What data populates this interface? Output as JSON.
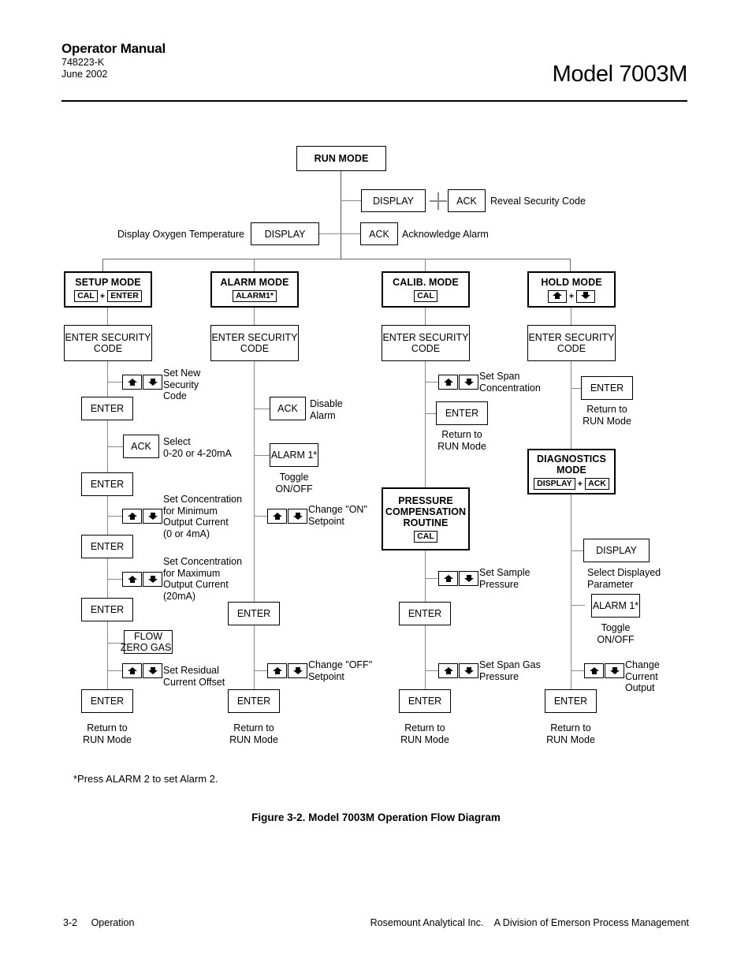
{
  "header": {
    "title": "Operator Manual",
    "doc_number": "748223-K",
    "date": "June 2002",
    "model": "Model 7003M"
  },
  "diagram": {
    "run_mode": "RUN MODE",
    "reveal": {
      "display_key": "DISPLAY",
      "ack_key": "ACK",
      "label": "Reveal Security Code"
    },
    "acknowledge": {
      "display_key": "DISPLAY",
      "display_label": "Display Oxygen Temperature",
      "ack_key": "ACK",
      "ack_label": "Acknowledge Alarm"
    },
    "modes": [
      {
        "name": "SETUP MODE",
        "keys": [
          "CAL",
          "ENTER"
        ],
        "separator": "+",
        "security": "ENTER SECURITY\nCODE"
      },
      {
        "name": "ALARM MODE",
        "keys": [
          "ALARM1*"
        ],
        "separator": "",
        "security": "ENTER SECURITY\nCODE"
      },
      {
        "name": "CALIB. MODE",
        "keys": [
          "CAL"
        ],
        "separator": "",
        "security": "ENTER SECURITY\nCODE"
      },
      {
        "name": "HOLD MODE",
        "keys": [
          "up-arrow",
          "down-arrow"
        ],
        "separator": "+",
        "security": "ENTER SECURITY\nCODE"
      }
    ],
    "setup_column": {
      "step1_label": "Set New\nSecurity\nCode",
      "enter1": "ENTER",
      "ack_box": "ACK",
      "ack_label": "Select\n0-20 or 4-20mA",
      "enter2": "ENTER",
      "step3_label": "Set Concentration\nfor Minimum\nOutput Current",
      "step3_sub": "(0 or 4mA)",
      "enter3": "ENTER",
      "step4_label": "Set Concentration\nfor Maximum\nOutput Current",
      "step4_sub": "(20mA)",
      "enter4": "ENTER",
      "flow_box_line1": "FLOW",
      "flow_box_line2": "ZERO GAS",
      "step5_label": "Set Residual\nCurrent Offset",
      "enter5": "ENTER",
      "return_label": "Return to\nRUN Mode"
    },
    "alarm_column": {
      "ack_box": "ACK",
      "ack_label": "Disable\nAlarm",
      "alarm_box": "ALARM 1*",
      "toggle_label": "Toggle\nON/OFF",
      "on_label": "Change \"ON\"\nSetpoint",
      "enter1": "ENTER",
      "off_label": "Change \"OFF\"\nSetpoint",
      "enter2": "ENTER",
      "return_label": "Return to\nRUN Mode"
    },
    "calib_column": {
      "span_label": "Set Span\nConcentration",
      "enter1": "ENTER",
      "return1_label": "Return to\nRUN Mode",
      "pressure_box": "PRESSURE\nCOMPENSATION\nROUTINE",
      "pressure_key": "CAL",
      "sample_label": "Set Sample\nPressure",
      "enter2": "ENTER",
      "span_gas_label": "Set Span Gas\nPressure",
      "enter3": "ENTER",
      "return2_label": "Return to\nRUN Mode"
    },
    "hold_column": {
      "enter1": "ENTER",
      "return1_label": "Return to\nRUN Mode",
      "diagnostics_box": "DIAGNOSTICS\nMODE",
      "diagnostics_keys": [
        "DISPLAY",
        "ACK"
      ],
      "diagnostics_separator": "+",
      "display_box": "DISPLAY",
      "display_label": "Select Displayed\nParameter",
      "alarm_box": "ALARM 1*",
      "toggle_label": "Toggle\nON/OFF",
      "change_label": "Change\nCurrent\nOutput",
      "enter2": "ENTER",
      "return2_label": "Return to\nRUN Mode"
    },
    "footnote": "*Press ALARM 2 to set Alarm 2.",
    "caption": "Figure 3-2.   Model 7003M Operation Flow Diagram"
  },
  "footer": {
    "page": "3-2",
    "section": "Operation",
    "company": "Rosemount Analytical Inc.    A Division of Emerson Process Management"
  }
}
